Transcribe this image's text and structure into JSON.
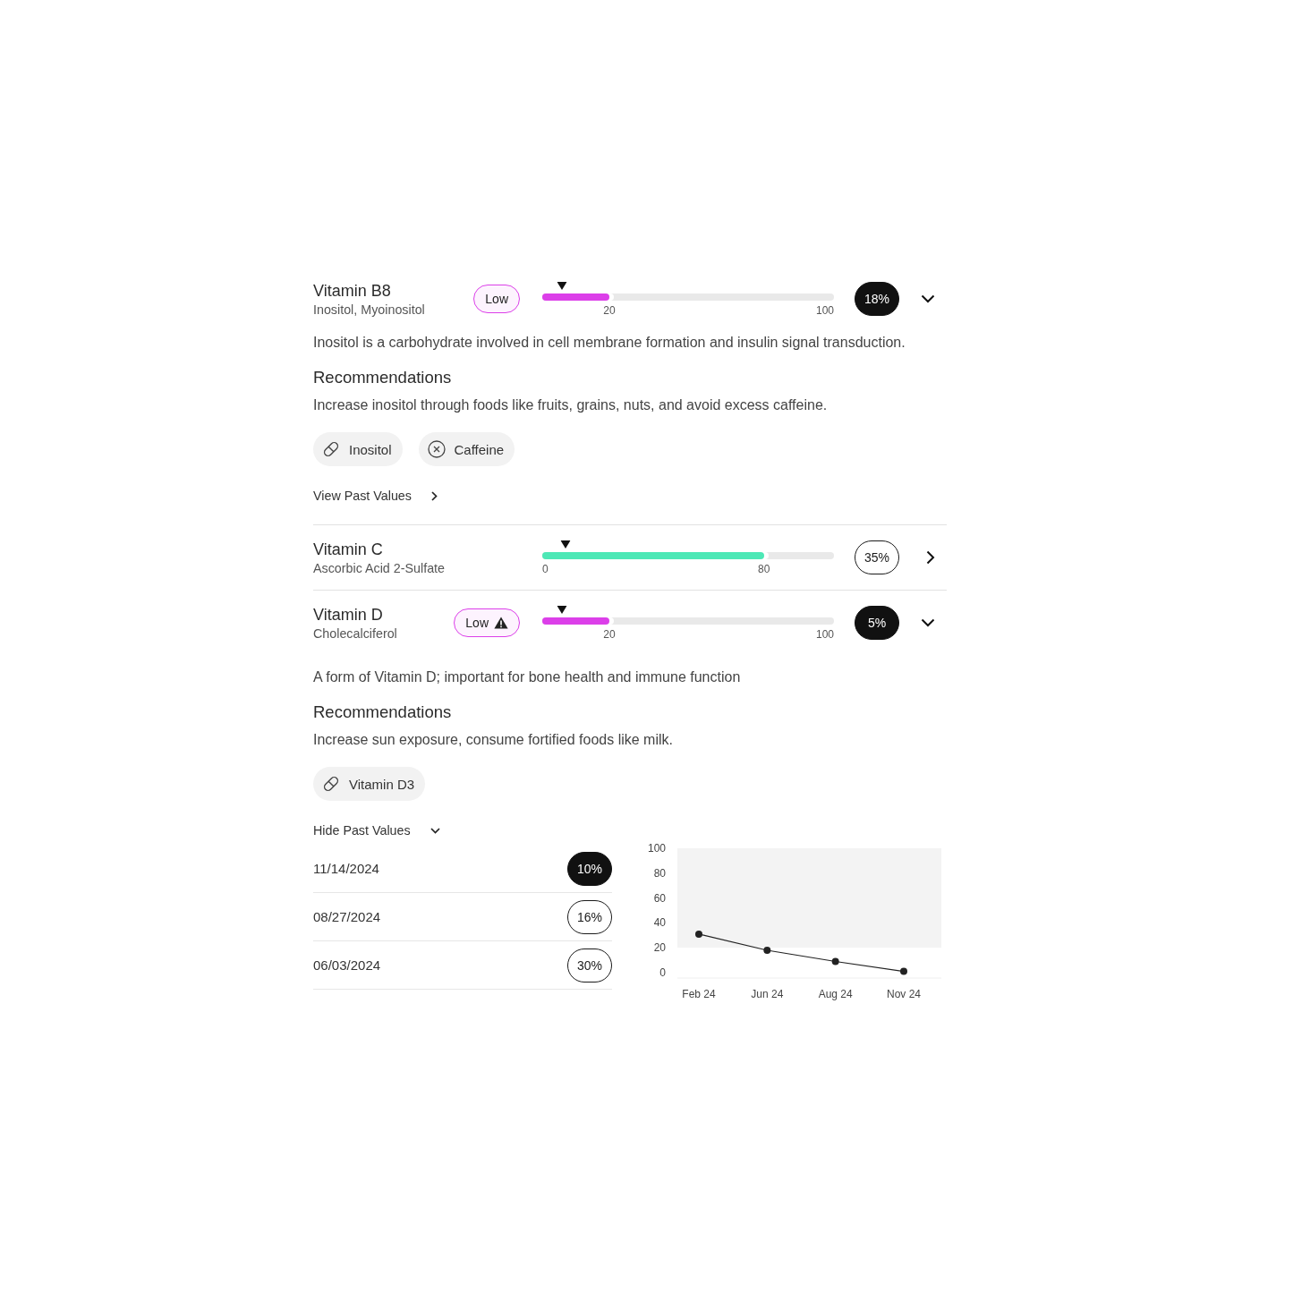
{
  "vitamins": [
    {
      "name": "Vitamin B8",
      "subtitle": "Inositol, Myoinositol",
      "badge": {
        "label": "Low",
        "warning": false
      },
      "bar": {
        "color": "#dc3fe9",
        "level": 0.23,
        "marker": {
          "level": 0.067
        },
        "split_label": "20",
        "end_label": "100"
      },
      "score": {
        "text": "18%",
        "highlighted": true
      },
      "expanded": true,
      "details": {
        "description": "Inositol is a carbohydrate involved in cell membrane formation and insulin signal transduction.",
        "recommendations_title": "Recommendations",
        "recommendations_text": "Increase inositol through foods like fruits, grains, nuts, and avoid excess caffeine.",
        "chips": [
          {
            "kind": "supplement",
            "label": "Inositol"
          },
          {
            "kind": "avoid",
            "label": "Caffeine"
          }
        ],
        "past_values": {
          "label": "View Past Values",
          "expanded": false
        }
      }
    },
    {
      "name": "Vitamin C",
      "subtitle": "Ascorbic Acid 2-Sulfate",
      "bar": {
        "color": "#4de8b6",
        "level": 0.76,
        "marker": {
          "level": 0.08
        },
        "start_label": "0",
        "split_label": "80"
      },
      "score": {
        "text": "35%",
        "highlighted": false
      },
      "expanded": false
    },
    {
      "name": "Vitamin D",
      "subtitle": "Cholecalciferol",
      "badge": {
        "label": "Low",
        "warning": true
      },
      "bar": {
        "color": "#dc3fe9",
        "level": 0.23,
        "marker": {
          "level": 0.067
        },
        "split_label": "20",
        "end_label": "100"
      },
      "score": {
        "text": "5%",
        "highlighted": true
      },
      "expanded": true,
      "details": {
        "description": "A form of Vitamin D; important for bone health and immune function",
        "recommendations_title": "Recommendations",
        "recommendations_text": "Increase sun exposure, consume fortified foods like milk.",
        "chips": [
          {
            "kind": "supplement",
            "label": "Vitamin D3"
          }
        ],
        "past_values": {
          "label": "Hide Past Values",
          "expanded": true,
          "history": [
            {
              "date": "11/14/2024",
              "value": "10%",
              "highlighted": true
            },
            {
              "date": "08/27/2024",
              "value": "16%",
              "highlighted": false
            },
            {
              "date": "06/03/2024",
              "value": "30%",
              "highlighted": false
            }
          ],
          "chart_data": {
            "type": "line",
            "categories": [
              "Feb 24",
              "Jun 24",
              "Aug 24",
              "Nov 24"
            ],
            "series": [
              {
                "color": "#222222",
                "marker": "o",
                "values": [
                  31,
                  18,
                  9,
                  1
                ]
              }
            ],
            "ylim": [
              0,
              100
            ],
            "yticks": [
              0,
              20,
              40,
              60,
              80,
              100
            ],
            "bands": [
              {
                "axis": "y",
                "from": 20,
                "to": 100
              }
            ]
          }
        }
      }
    }
  ]
}
